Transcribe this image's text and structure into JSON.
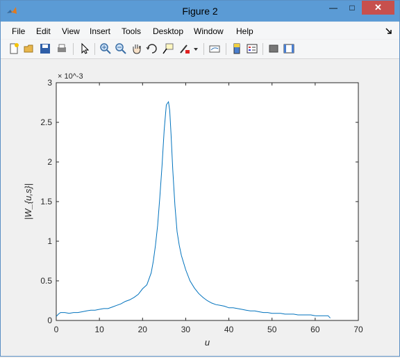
{
  "window": {
    "title": "Figure 2",
    "close_glyph": "✕",
    "maximize_glyph": "□",
    "minimize_glyph": "—"
  },
  "menu": [
    "File",
    "Edit",
    "View",
    "Insert",
    "Tools",
    "Desktop",
    "Window",
    "Help"
  ],
  "toolbar_icons": [
    "new-figure-icon",
    "open-file-icon",
    "save-icon",
    "print-icon",
    "pointer-icon",
    "zoom-in-icon",
    "zoom-out-icon",
    "pan-hand-icon",
    "rotate-3d-icon",
    "data-cursor-icon",
    "brush-icon",
    "brush-dropdown-icon",
    "link-plot-icon",
    "colorbar-icon",
    "legend-icon",
    "hide-plot-tools-icon",
    "show-plot-tools-icon"
  ],
  "colors": {
    "titlebar": "#5b9bd5",
    "close_button": "#c7504d",
    "line": "#0072bd"
  },
  "chart_data": {
    "type": "line",
    "xlabel": "u",
    "ylabel": "|W_{u,s}|",
    "exponent_label": "× 10^-3",
    "y_exponent": -3,
    "xlim": [
      0,
      70
    ],
    "ylim": [
      0,
      3
    ],
    "xticks": [
      0,
      10,
      20,
      30,
      40,
      50,
      60,
      70
    ],
    "yticks": [
      0,
      0.5,
      1,
      1.5,
      2,
      2.5,
      3
    ],
    "grid": false,
    "series": [
      {
        "x": [
          0,
          0.5,
          1,
          2,
          3,
          4,
          5,
          6,
          7,
          8,
          9,
          10,
          11,
          12,
          13,
          14,
          15,
          16,
          17,
          18,
          19,
          20,
          21,
          22,
          22.5,
          23,
          23.5,
          24,
          24.5,
          25,
          25.5,
          26,
          26.3,
          26.6,
          27,
          27.5,
          28,
          28.5,
          29,
          30,
          31,
          32,
          33,
          34,
          35,
          36,
          37,
          38,
          39,
          40,
          41,
          42,
          43,
          44,
          45,
          46,
          47,
          48,
          49,
          50,
          51,
          52,
          53,
          54,
          55,
          56,
          57,
          58,
          59,
          60,
          61,
          62,
          63,
          63.5
        ],
        "y": [
          0.05,
          0.08,
          0.1,
          0.1,
          0.09,
          0.1,
          0.1,
          0.11,
          0.12,
          0.13,
          0.13,
          0.14,
          0.15,
          0.15,
          0.17,
          0.19,
          0.21,
          0.24,
          0.26,
          0.29,
          0.33,
          0.4,
          0.45,
          0.6,
          0.75,
          0.95,
          1.2,
          1.55,
          1.95,
          2.4,
          2.72,
          2.76,
          2.65,
          2.35,
          1.9,
          1.45,
          1.12,
          0.95,
          0.82,
          0.64,
          0.5,
          0.41,
          0.34,
          0.29,
          0.25,
          0.22,
          0.2,
          0.19,
          0.18,
          0.16,
          0.16,
          0.15,
          0.14,
          0.13,
          0.12,
          0.12,
          0.11,
          0.1,
          0.1,
          0.09,
          0.09,
          0.09,
          0.08,
          0.08,
          0.08,
          0.07,
          0.07,
          0.07,
          0.07,
          0.06,
          0.06,
          0.06,
          0.06,
          0.03
        ]
      }
    ]
  }
}
